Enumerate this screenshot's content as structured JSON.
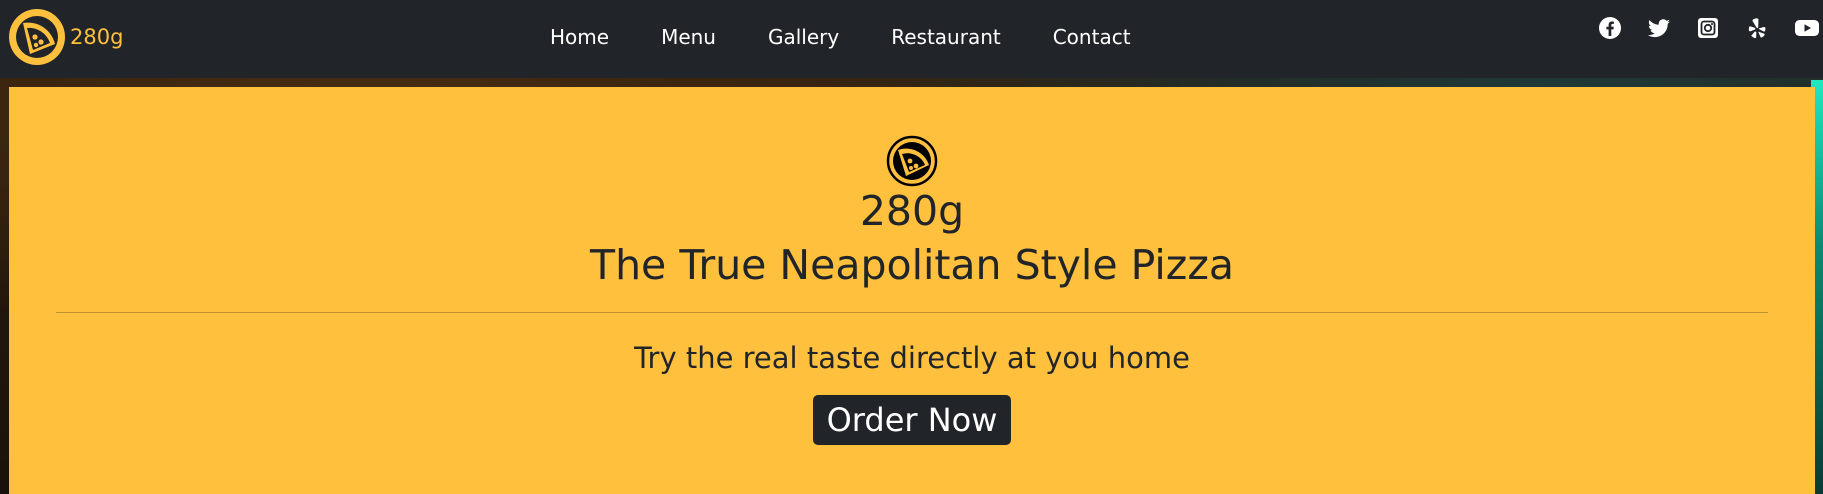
{
  "nav": {
    "brand_text": "280g",
    "brand_icon": "pizza-slice-icon",
    "links": [
      {
        "label": "Home"
      },
      {
        "label": "Menu"
      },
      {
        "label": "Gallery"
      },
      {
        "label": "Restaurant"
      },
      {
        "label": "Contact"
      }
    ],
    "social": [
      {
        "icon": "facebook-icon"
      },
      {
        "icon": "twitter-icon"
      },
      {
        "icon": "instagram-icon"
      },
      {
        "icon": "yelp-icon"
      },
      {
        "icon": "youtube-icon"
      }
    ]
  },
  "hero": {
    "logo_icon": "pizza-slice-icon",
    "name": "280g",
    "title": "The True Neapolitan Style Pizza",
    "subtitle": "Try the real taste directly at you home",
    "cta_label": "Order Now"
  },
  "colors": {
    "brand_yellow": "#ffc03e",
    "dark": "#212529",
    "white": "#ffffff"
  }
}
